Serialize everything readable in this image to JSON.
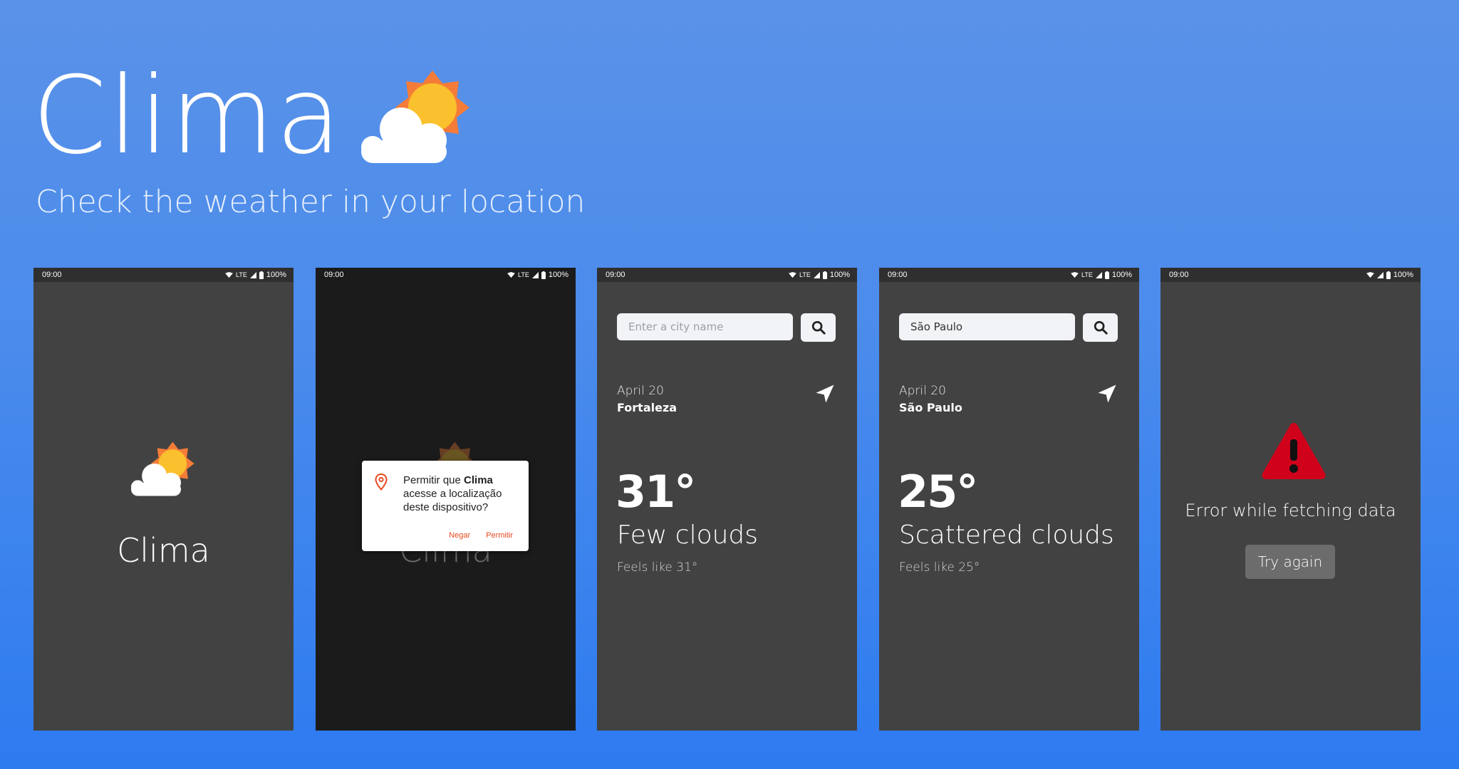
{
  "hero": {
    "title": "Clima",
    "subtitle": "Check the weather in your location",
    "logo_icon": "sun-cloud-icon"
  },
  "status": {
    "time": "09:00",
    "network": "LTE",
    "battery": "100%"
  },
  "colors": {
    "background_top": "#5a92e8",
    "background_bottom": "#2d7bf0",
    "phone_bg": "#424242",
    "accent": "#e8491f",
    "error_red": "#d0021b",
    "sun": "#fbc02d",
    "sun_rays": "#f57c38"
  },
  "screens": [
    {
      "id": "splash",
      "app_name": "Clima"
    },
    {
      "id": "permission",
      "app_name": "Clima",
      "dialog": {
        "text_before": "Permitir que ",
        "app_bold": "Clima",
        "text_after": " acesse a localização deste dispositivo?",
        "deny_label": "Negar",
        "allow_label": "Permitir"
      }
    },
    {
      "id": "weather-fortaleza",
      "search_placeholder": "Enter a city name",
      "search_value": "",
      "date": "April 20",
      "city": "Fortaleza",
      "temp": "31°",
      "description": "Few clouds",
      "feels_like": "Feels like 31°"
    },
    {
      "id": "weather-sao-paulo",
      "search_placeholder": "Enter a city name",
      "search_value": "São Paulo",
      "date": "April 20",
      "city": "São Paulo",
      "temp": "25°",
      "description": "Scattered clouds",
      "feels_like": "Feels like 25°"
    },
    {
      "id": "error",
      "error_text": "Error while fetching data",
      "retry_label": "Try again"
    }
  ]
}
